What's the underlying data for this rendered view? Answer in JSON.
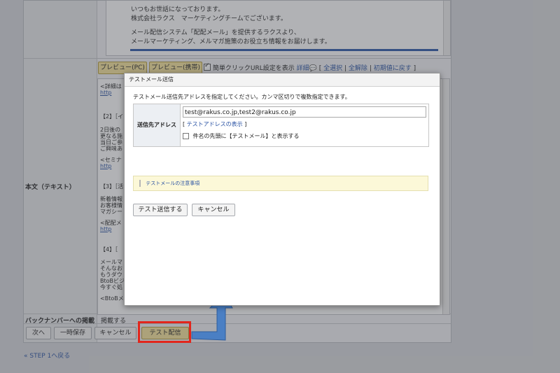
{
  "top_text": {
    "line1": "いつもお世話になっております。",
    "line2": "株式会社ラクス　マーケティングチームでございます。",
    "line3": "メール配信システム「配配メール」を提供するラクスより、",
    "line4": "メールマーケティング、メルマガ施策のお役立ち情報をお届けします。"
  },
  "labels": {
    "body_text": "本文（テキスト）",
    "backnumber": "バックナンバーへの掲載",
    "backnumber_value": "掲載する"
  },
  "toolbar": {
    "preview_pc": "プレビュー(PC)",
    "preview_mobile": "プレビュー(携帯)",
    "click_url_label": "簡単クリックURL設定を表示",
    "detail_link": "詳細",
    "bracket_open": "[",
    "select_all": "全選択",
    "separator": "|",
    "deselect_all": "全解除",
    "reset_initial": "初期値に戻す",
    "bracket_close": "]"
  },
  "body_fragments": {
    "f1": "<詳細は",
    "f2": "【2】［イ",
    "f3": "2日後の",
    "f4": "更なる施",
    "f5": "当日ご参",
    "f6": "ご興味あ",
    "f7": "<セミナ",
    "f8": "【3】［活",
    "f9": "新着情報",
    "f10": "お客様情",
    "f11": "マガシー",
    "f12": "<配配メ",
    "f13": "【4】［",
    "f14": "メールマ",
    "f15": "そんなお",
    "f16": "もうダウ",
    "f17": "BtoBビジ",
    "f18": "今すぐ処",
    "f19": "<BtoBメ",
    "link_frag": "http"
  },
  "bottom_buttons": {
    "next": "次へ",
    "temp_save": "一時保存",
    "cancel": "キャンセル",
    "test_send": "テスト配信"
  },
  "back_link": "STEP 1へ戻る",
  "modal": {
    "title": "テストメール送信",
    "instruction": "テストメール送信先アドレスを指定してください。カンマ区切りで複数指定できます。",
    "field_label": "送信先アドレス",
    "address_value": "test@rakus.co.jp,test2@rakus.co.jp",
    "bracket_open": "[",
    "show_test_address_link": "テストアドレスの表示",
    "bracket_close": "]",
    "subject_prefix_label": "件名の先頭に【テストメール】と表示する",
    "notice": "テストメールの注意事項",
    "send_button": "テスト送信する",
    "cancel_button": "キャンセル"
  },
  "colors": {
    "highlight_border": "#e2261c",
    "arrow_fill": "#4a7fc4",
    "link": "#2952a3",
    "preview_button": "#f6e39a"
  }
}
